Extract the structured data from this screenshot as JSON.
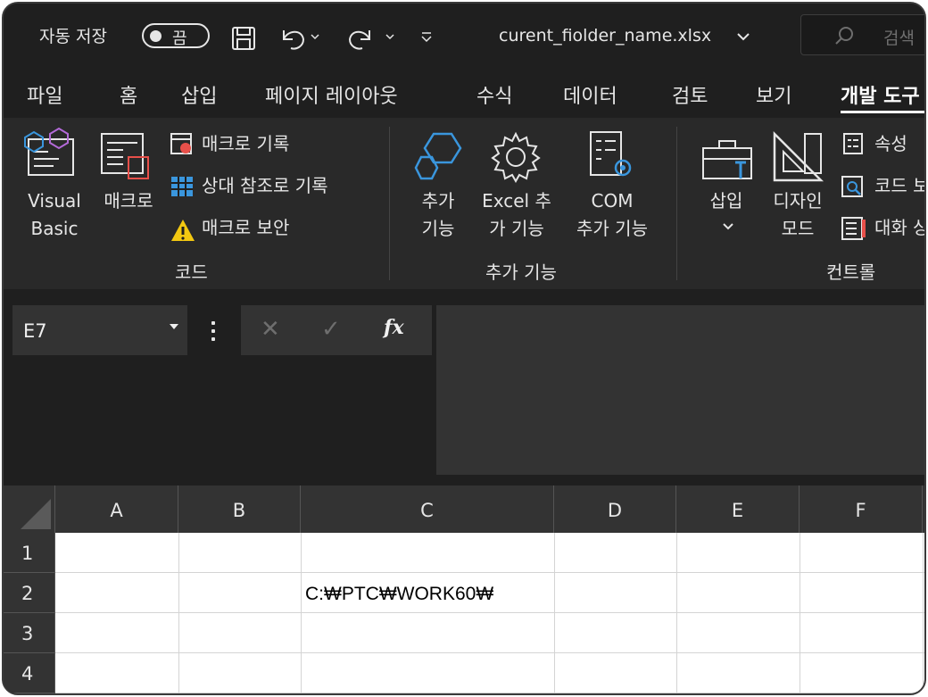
{
  "titlebar": {
    "autosave_label": "자동 저장",
    "autosave_state": "끔",
    "filename": "curent_fiolder_name.xlsx",
    "filename_chevron": "⌄",
    "search_placeholder": "검색"
  },
  "tabs": [
    "파일",
    "홈",
    "삽입",
    "페이지 레이아웃",
    "수식",
    "데이터",
    "검토",
    "보기",
    "개발 도구"
  ],
  "active_tab": "개발 도구",
  "ribbon": {
    "code": {
      "group_label": "코드",
      "visual_basic": [
        "Visual",
        "Basic"
      ],
      "macros": "매크로",
      "record_macro": "매크로 기록",
      "relative_ref": "상대 참조로 기록",
      "macro_security": "매크로 보안"
    },
    "addins": {
      "group_label": "추가 기능",
      "addins": [
        "추가",
        "기능"
      ],
      "excel_addins": [
        "Excel 추",
        "가 기능"
      ],
      "com_addins": [
        "COM",
        "추가 기능"
      ]
    },
    "controls": {
      "group_label": "컨트롤",
      "insert": [
        "삽입",
        "⌄"
      ],
      "design_mode": [
        "디자인",
        "모드"
      ],
      "properties": "속성",
      "view_code": "코드 보기",
      "run_dialog": "대화 상자 실행"
    }
  },
  "formula_bar": {
    "name_box": "E7",
    "cancel": "✕",
    "enter": "✓",
    "fx": "fx",
    "formula": ""
  },
  "sheet": {
    "columns": [
      "A",
      "B",
      "C",
      "D",
      "E",
      "F"
    ],
    "rows": [
      "1",
      "2",
      "3",
      "4"
    ],
    "cells": {
      "C2": "C:₩PTC₩WORK60₩"
    }
  },
  "colors": {
    "background": "#1f1f1f",
    "ribbon": "#292929",
    "accent_blue": "#3a96dd",
    "warning": "#f2c811"
  }
}
